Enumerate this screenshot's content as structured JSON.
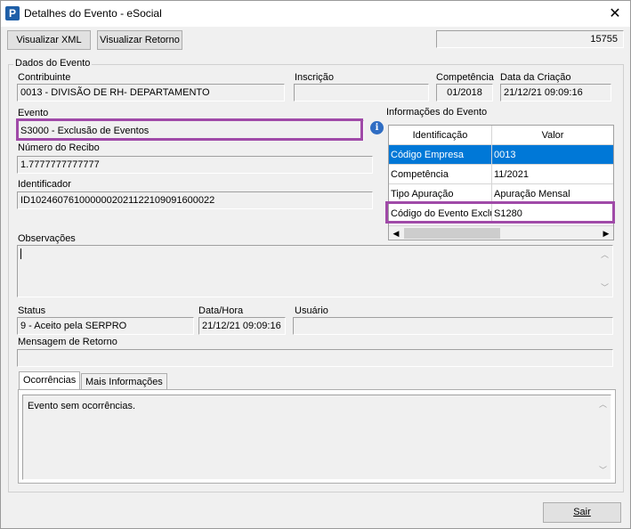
{
  "window": {
    "title": "Detalhes do Evento - eSocial",
    "app_icon": "P"
  },
  "toolbar": {
    "xml_label": "Visualizar XML",
    "retorno_label": "Visualizar Retorno",
    "id_value": "15755"
  },
  "group": {
    "title": "Dados do Evento"
  },
  "contribuinte": {
    "label": "Contribuinte",
    "value": "0013 - DIVISÃO DE RH- DEPARTAMENTO"
  },
  "inscricao": {
    "label": "Inscrição",
    "value": ""
  },
  "competencia": {
    "label": "Competência",
    "value": "01/2018"
  },
  "data_criacao": {
    "label": "Data da Criação",
    "value": "21/12/21 09:09:16"
  },
  "evento": {
    "label": "Evento",
    "value": "S3000 - Exclusão de Eventos"
  },
  "numero_recibo": {
    "label": "Número do Recibo",
    "value": "1.7777777777777"
  },
  "identificador": {
    "label": "Identificador",
    "value": "ID1024607610000002021122109091600022"
  },
  "informacoes": {
    "label": "Informações do Evento",
    "columns": [
      "Identificação",
      "Valor"
    ],
    "rows": [
      {
        "id": "Código Empresa",
        "valor": "0013",
        "selected": true
      },
      {
        "id": "Competência",
        "valor": "11/2021",
        "selected": false
      },
      {
        "id": "Tipo Apuração",
        "valor": "Apuração Mensal",
        "selected": false
      },
      {
        "id": "Código do Evento Exclu",
        "valor": "S1280",
        "selected": false
      }
    ]
  },
  "observacoes": {
    "label": "Observações",
    "value": ""
  },
  "status": {
    "label": "Status",
    "value": "9 - Aceito pela SERPRO"
  },
  "data_hora": {
    "label": "Data/Hora",
    "value": "21/12/21 09:09:16"
  },
  "usuario": {
    "label": "Usuário",
    "value": ""
  },
  "mensagem_retorno": {
    "label": "Mensagem de Retorno",
    "value": ""
  },
  "tabs": [
    {
      "label": "Ocorrências",
      "active": true
    },
    {
      "label": "Mais Informações",
      "active": false
    }
  ],
  "ocorrencias_text": "Evento sem ocorrências.",
  "footer": {
    "sair_label": "Sair"
  },
  "colors": {
    "highlight": "#a04aa8",
    "selection": "#0078d7"
  }
}
